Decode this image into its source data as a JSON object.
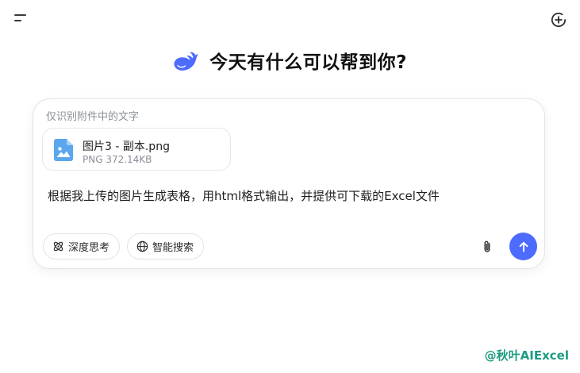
{
  "header": {
    "menu_icon": "menu-icon",
    "new_chat_icon": "new-chat-plus-icon"
  },
  "hero": {
    "logo_icon": "whale-logo-icon",
    "title": "今天有什么可以帮到你?"
  },
  "composer": {
    "hint": "仅识别附件中的文字",
    "attachment": {
      "icon": "image-file-icon",
      "name": "图片3 - 副本.png",
      "meta": "PNG 372.14KB"
    },
    "prompt": "根据我上传的图片生成表格，用html格式输出，并提供可下载的Excel文件",
    "deep_think": {
      "label": "深度思考",
      "icon": "atom-icon"
    },
    "web_search": {
      "label": "智能搜索",
      "icon": "globe-icon"
    },
    "attach_icon": "paperclip-icon",
    "send_icon": "arrow-up-icon"
  },
  "watermark": "@秋叶AIExcel",
  "colors": {
    "accent": "#4d6bfe",
    "file_icon": "#5aa7ee",
    "watermark": "#1e9c84"
  }
}
